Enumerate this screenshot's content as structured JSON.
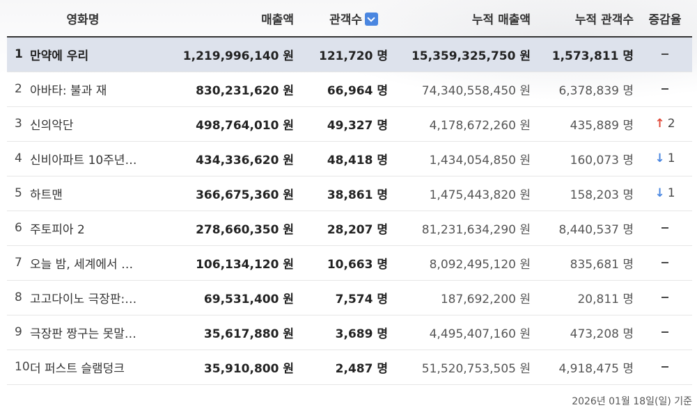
{
  "headers": {
    "title": "영화명",
    "sales": "매출액",
    "audience": "관객수",
    "cum_sales": "누적 매출액",
    "cum_audience": "누적 관객수",
    "change": "증감율"
  },
  "rows": [
    {
      "rank": "1",
      "title": "만약에 우리",
      "sales": "1,219,996,140 원",
      "audience": "121,720 명",
      "cum_sales": "15,359,325,750 원",
      "cum_audience": "1,573,811 명",
      "dir": "none",
      "change": ""
    },
    {
      "rank": "2",
      "title": "아바타: 불과 재",
      "sales": "830,231,620 원",
      "audience": "66,964 명",
      "cum_sales": "74,340,558,450 원",
      "cum_audience": "6,378,839 명",
      "dir": "none",
      "change": ""
    },
    {
      "rank": "3",
      "title": "신의악단",
      "sales": "498,764,010 원",
      "audience": "49,327 명",
      "cum_sales": "4,178,672,260 원",
      "cum_audience": "435,889 명",
      "dir": "up",
      "change": "2"
    },
    {
      "rank": "4",
      "title": "신비아파트 10주년…",
      "sales": "434,336,620 원",
      "audience": "48,418 명",
      "cum_sales": "1,434,054,850 원",
      "cum_audience": "160,073 명",
      "dir": "down",
      "change": "1"
    },
    {
      "rank": "5",
      "title": "하트맨",
      "sales": "366,675,360 원",
      "audience": "38,861 명",
      "cum_sales": "1,475,443,820 원",
      "cum_audience": "158,203 명",
      "dir": "down",
      "change": "1"
    },
    {
      "rank": "6",
      "title": "주토피아 2",
      "sales": "278,660,350 원",
      "audience": "28,207 명",
      "cum_sales": "81,231,634,290 원",
      "cum_audience": "8,440,537 명",
      "dir": "none",
      "change": ""
    },
    {
      "rank": "7",
      "title": "오늘 밤, 세계에서 …",
      "sales": "106,134,120 원",
      "audience": "10,663 명",
      "cum_sales": "8,092,495,120 원",
      "cum_audience": "835,681 명",
      "dir": "none",
      "change": ""
    },
    {
      "rank": "8",
      "title": "고고다이노 극장판:…",
      "sales": "69,531,400 원",
      "audience": "7,574 명",
      "cum_sales": "187,692,200 원",
      "cum_audience": "20,811 명",
      "dir": "none",
      "change": ""
    },
    {
      "rank": "9",
      "title": "극장판 짱구는 못말…",
      "sales": "35,617,880 원",
      "audience": "3,689 명",
      "cum_sales": "4,495,407,160 원",
      "cum_audience": "473,208 명",
      "dir": "none",
      "change": ""
    },
    {
      "rank": "10",
      "title": "더 퍼스트 슬램덩크",
      "sales": "35,910,800 원",
      "audience": "2,487 명",
      "cum_sales": "51,520,753,505 원",
      "cum_audience": "4,918,475 명",
      "dir": "none",
      "change": ""
    }
  ],
  "footer": "2026년 01월 18일(일) 기준",
  "colors": {
    "up": "#e04a3a",
    "down": "#4a86e0",
    "highlight_row": "#dde2ec",
    "sort_button": "#4a86e0"
  },
  "icons": {
    "up": "arrow-up-icon",
    "down": "arrow-down-icon",
    "sort": "chevron-down-icon"
  }
}
